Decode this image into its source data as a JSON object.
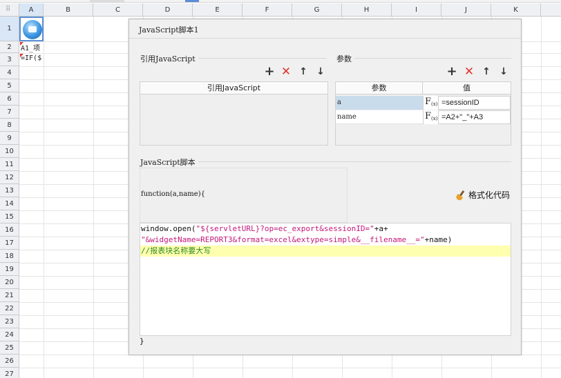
{
  "sheet": {
    "columns": [
      "A",
      "B",
      "C",
      "D",
      "E",
      "F",
      "G",
      "H",
      "I",
      "J",
      "K"
    ],
    "rows": [
      "1",
      "2",
      "3",
      "4",
      "5",
      "6",
      "7",
      "8",
      "9",
      "10",
      "11",
      "12",
      "13",
      "14",
      "15",
      "16",
      "17",
      "18",
      "19",
      "20",
      "21",
      "22",
      "23",
      "24",
      "25",
      "26",
      "27"
    ],
    "selected_column": "A",
    "selected_row": "1",
    "cell_a2": "A1_项",
    "cell_a3": "=IF($"
  },
  "dialog": {
    "title": "JavaScript脚本1",
    "ref_js": {
      "legend": "引用JavaScript",
      "column_header": "引用JavaScript",
      "items": []
    },
    "params": {
      "legend": "参数",
      "col_name": "参数",
      "col_value": "值",
      "rows": [
        {
          "name": "a",
          "value": "=sessionID"
        },
        {
          "name": "name",
          "value": "=A2+\"_\"+A3"
        }
      ]
    },
    "toolbar_icons": [
      "add-icon",
      "delete-icon",
      "up-arrow-icon",
      "down-arrow-icon"
    ],
    "script": {
      "legend": "JavaScript脚本",
      "function_decl": "function(a,name){",
      "format_label": "格式化代码",
      "line1_a": "window.open(",
      "line1_b": "\"${servletURL}?op=ec_export&sessionID=\"",
      "line1_c": "+a+",
      "line2_a": "\"&widgetName=REPORT3&format=excel&extype=simple&__filename__=\"",
      "line2_b": "+name)",
      "line3": "//报表块名称要大写",
      "closing": "}"
    }
  },
  "colors": {
    "string": "#c2187a",
    "comment": "#2f8a1f",
    "highlight_line": "#ffffb0",
    "selected_param": "#c9dcec",
    "delete": "#e0342c"
  }
}
